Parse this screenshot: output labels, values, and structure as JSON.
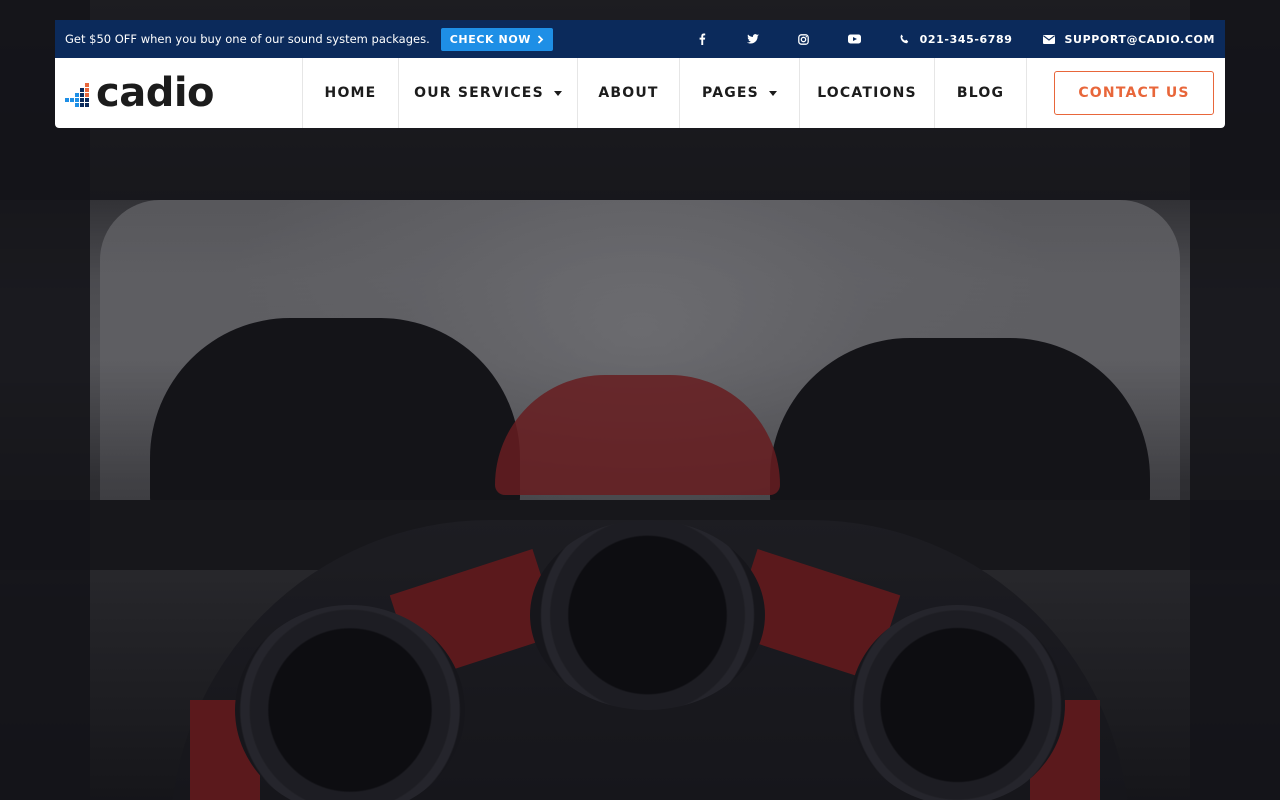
{
  "promo": {
    "text": "Get $50 OFF when you buy one of our sound system packages.",
    "cta_label": "CHECK NOW",
    "cta_icon": "chevron-right-icon"
  },
  "topbar": {
    "socials": [
      {
        "name": "facebook-icon",
        "glyph": "f"
      },
      {
        "name": "twitter-icon",
        "glyph": "t"
      },
      {
        "name": "instagram-icon",
        "glyph": "◎"
      },
      {
        "name": "youtube-icon",
        "glyph": "▶"
      }
    ],
    "phone": "021-345-6789",
    "email": "SUPPORT@CADIO.COM"
  },
  "logo": {
    "text": "cadio",
    "colors": [
      "#1e8fe6",
      "#e8663a",
      "#0b2a5b"
    ]
  },
  "nav": {
    "items": [
      {
        "label": "HOME",
        "dropdown": false
      },
      {
        "label": "OUR SERVICES",
        "dropdown": true
      },
      {
        "label": "ABOUT",
        "dropdown": false
      },
      {
        "label": "PAGES",
        "dropdown": true
      },
      {
        "label": "LOCATIONS",
        "dropdown": false
      },
      {
        "label": "BLOG",
        "dropdown": false
      }
    ],
    "contact_label": "CONTACT US"
  },
  "colors": {
    "topbar_bg": "#0b2a5b",
    "accent_blue": "#1e8fe6",
    "accent_orange": "#e8663a"
  }
}
